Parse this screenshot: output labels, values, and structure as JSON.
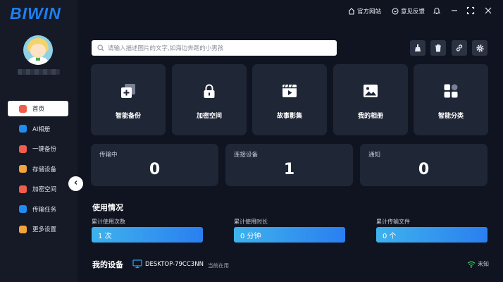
{
  "app": {
    "logo_text": "BIWIN"
  },
  "topbar": {
    "official_site": "官方网站",
    "feedback": "意见反馈"
  },
  "sidebar": {
    "items": [
      {
        "label": "首页",
        "active": true,
        "icon": "home-icon",
        "color": "#f25c4a"
      },
      {
        "label": "AI相册",
        "active": false,
        "icon": "ai-album-icon",
        "color": "#1e8cf0"
      },
      {
        "label": "一键备份",
        "active": false,
        "icon": "backup-icon",
        "color": "#f25c4a"
      },
      {
        "label": "存储设备",
        "active": false,
        "icon": "storage-icon",
        "color": "#f2a43a"
      },
      {
        "label": "加密空间",
        "active": false,
        "icon": "encrypt-icon",
        "color": "#f25c4a"
      },
      {
        "label": "传输任务",
        "active": false,
        "icon": "transfer-icon",
        "color": "#1e8cf0"
      },
      {
        "label": "更多设置",
        "active": false,
        "icon": "settings-icon",
        "color": "#f2a43a"
      }
    ]
  },
  "search": {
    "placeholder": "请输入描述图片的文字,如海边奔跑的小男孩"
  },
  "toolbar": {
    "icons": [
      "brush-icon",
      "trash-icon",
      "link-icon",
      "gear-icon"
    ]
  },
  "tiles": [
    {
      "label": "智能备份",
      "icon": "smart-backup-icon"
    },
    {
      "label": "加密空间",
      "icon": "lock-icon"
    },
    {
      "label": "故事影集",
      "icon": "video-icon"
    },
    {
      "label": "我的相册",
      "icon": "image-icon"
    },
    {
      "label": "智能分类",
      "icon": "category-icon"
    }
  ],
  "stats": [
    {
      "title": "传输中",
      "value": "0"
    },
    {
      "title": "连接设备",
      "value": "1"
    },
    {
      "title": "通知",
      "value": "0"
    }
  ],
  "usage": {
    "title": "使用情况",
    "items": [
      {
        "label": "累计使用次数",
        "value": "1 次"
      },
      {
        "label": "累计使用时长",
        "value": "0 分钟"
      },
      {
        "label": "累计传输文件",
        "value": "0 个"
      }
    ]
  },
  "devices": {
    "title": "我的设备",
    "name": "DESKTOP-79CC3NN",
    "status": "当前在用",
    "network": "未知"
  }
}
